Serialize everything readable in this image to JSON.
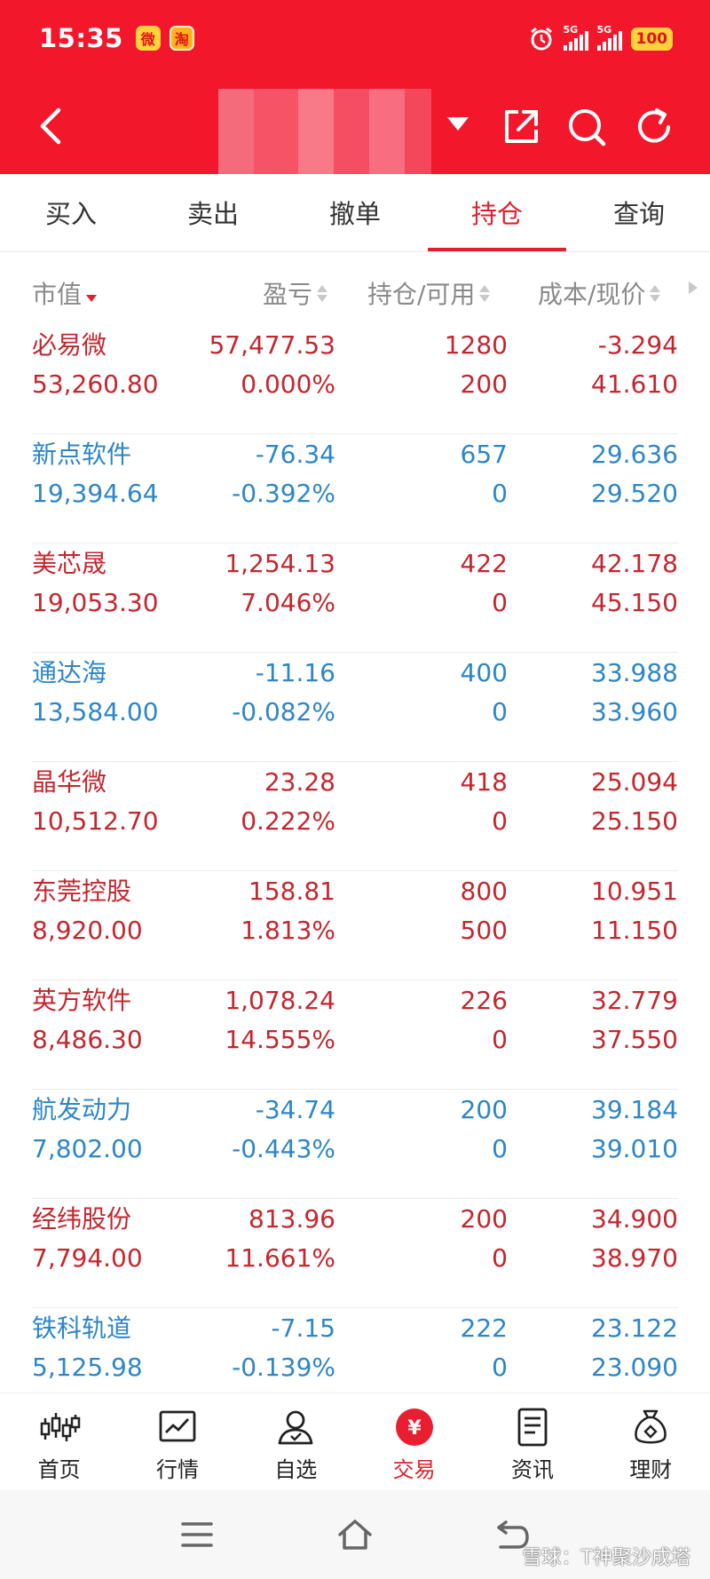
{
  "status_bar": {
    "time": "15:35",
    "weibo_glyph": "微",
    "taobao_glyph": "淘",
    "signal_label": "5G",
    "battery": "100"
  },
  "colors": {
    "header_bg": "#f3172b",
    "accent_red": "#e0202f",
    "gain_red": "#c4262e",
    "loss_blue": "#2d86c8"
  },
  "tabs": [
    {
      "label": "买入"
    },
    {
      "label": "卖出"
    },
    {
      "label": "撤单"
    },
    {
      "label": "持仓",
      "active": true
    },
    {
      "label": "查询"
    }
  ],
  "columns": {
    "market_value": "市值",
    "profit_loss": "盈亏",
    "position_available": "持仓/可用",
    "cost_price": "成本/现价"
  },
  "holdings": [
    {
      "name": "必易微",
      "market_value": "53,260.80",
      "pl": "57,477.53",
      "pl_pct": "0.000%",
      "position": "1280",
      "available": "200",
      "cost": "-3.294",
      "price": "41.610",
      "color": "red"
    },
    {
      "name": "新点软件",
      "market_value": "19,394.64",
      "pl": "-76.34",
      "pl_pct": "-0.392%",
      "position": "657",
      "available": "0",
      "cost": "29.636",
      "price": "29.520",
      "color": "blue"
    },
    {
      "name": "美芯晟",
      "market_value": "19,053.30",
      "pl": "1,254.13",
      "pl_pct": "7.046%",
      "position": "422",
      "available": "0",
      "cost": "42.178",
      "price": "45.150",
      "color": "red"
    },
    {
      "name": "通达海",
      "market_value": "13,584.00",
      "pl": "-11.16",
      "pl_pct": "-0.082%",
      "position": "400",
      "available": "0",
      "cost": "33.988",
      "price": "33.960",
      "color": "blue"
    },
    {
      "name": "晶华微",
      "market_value": "10,512.70",
      "pl": "23.28",
      "pl_pct": "0.222%",
      "position": "418",
      "available": "0",
      "cost": "25.094",
      "price": "25.150",
      "color": "red"
    },
    {
      "name": "东莞控股",
      "market_value": "8,920.00",
      "pl": "158.81",
      "pl_pct": "1.813%",
      "position": "800",
      "available": "500",
      "cost": "10.951",
      "price": "11.150",
      "color": "red"
    },
    {
      "name": "英方软件",
      "market_value": "8,486.30",
      "pl": "1,078.24",
      "pl_pct": "14.555%",
      "position": "226",
      "available": "0",
      "cost": "32.779",
      "price": "37.550",
      "color": "red"
    },
    {
      "name": "航发动力",
      "market_value": "7,802.00",
      "pl": "-34.74",
      "pl_pct": "-0.443%",
      "position": "200",
      "available": "0",
      "cost": "39.184",
      "price": "39.010",
      "color": "blue"
    },
    {
      "name": "经纬股份",
      "market_value": "7,794.00",
      "pl": "813.96",
      "pl_pct": "11.661%",
      "position": "200",
      "available": "0",
      "cost": "34.900",
      "price": "38.970",
      "color": "red"
    },
    {
      "name": "铁科轨道",
      "market_value": "5,125.98",
      "pl": "-7.15",
      "pl_pct": "-0.139%",
      "position": "222",
      "available": "0",
      "cost": "23.122",
      "price": "23.090",
      "color": "blue"
    }
  ],
  "bottom_nav": [
    {
      "label": "首页",
      "icon": "candlestick-icon"
    },
    {
      "label": "行情",
      "icon": "chart-icon"
    },
    {
      "label": "自选",
      "icon": "person-icon"
    },
    {
      "label": "交易",
      "icon": "yuan-icon",
      "active": true
    },
    {
      "label": "资讯",
      "icon": "document-icon"
    },
    {
      "label": "理财",
      "icon": "money-bag-icon"
    }
  ],
  "trade_glyph": "¥",
  "watermark": "雪球：T神聚沙成塔"
}
